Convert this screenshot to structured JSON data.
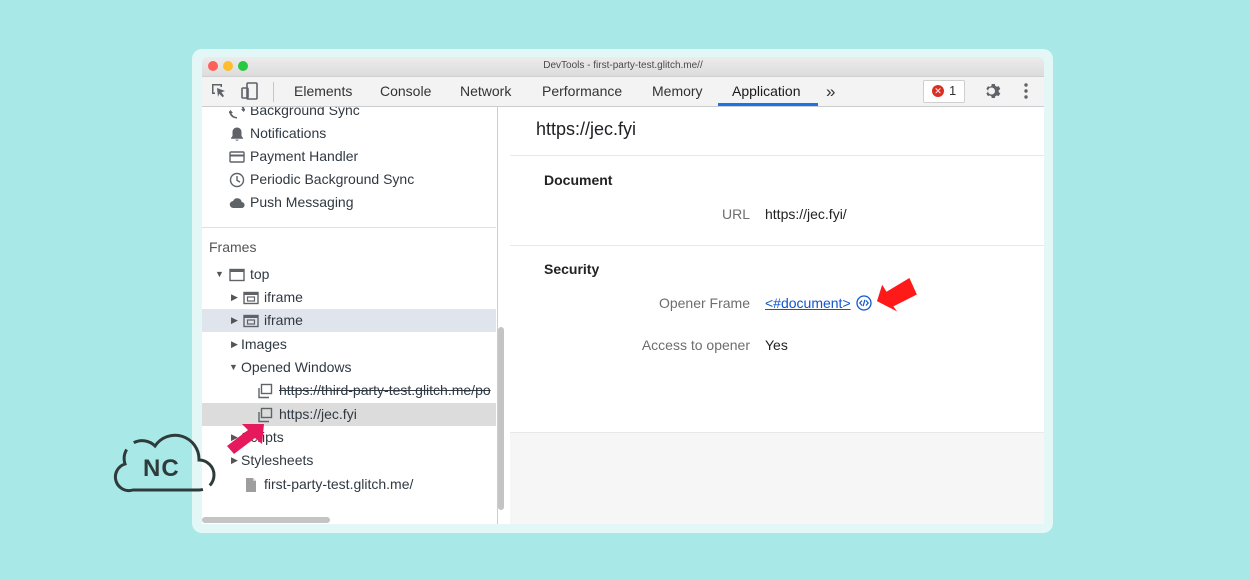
{
  "window": {
    "title": "DevTools - first-party-test.glitch.me//"
  },
  "toolbar": {
    "tabs": [
      "Elements",
      "Console",
      "Network",
      "Performance",
      "Memory",
      "Application"
    ],
    "active_tab": "Application",
    "more": "»",
    "error_count": "1"
  },
  "sidebar": {
    "items": [
      "Background Sync",
      "Notifications",
      "Payment Handler",
      "Periodic Background Sync",
      "Push Messaging"
    ],
    "frames_header": "Frames",
    "frames": {
      "top": "top",
      "iframe1": "iframe",
      "iframe2": "iframe",
      "images": "Images",
      "opened_windows": "Opened Windows",
      "window1": "https://third-party-test.glitch.me/po",
      "window2": "https://jec.fyi",
      "scripts": "Scripts",
      "stylesheets": "Stylesheets",
      "file": "first-party-test.glitch.me/"
    }
  },
  "main": {
    "title": "https://jec.fyi",
    "document": {
      "header": "Document",
      "url_label": "URL",
      "url_value": "https://jec.fyi/"
    },
    "security": {
      "header": "Security",
      "opener_label": "Opener Frame",
      "opener_value": "<#document>",
      "access_label": "Access to opener",
      "access_value": "Yes"
    }
  },
  "logo": {
    "text": "NC"
  },
  "colors": {
    "accent": "#1a73e8",
    "arrow_red": "#ff1a1a",
    "arrow_pink": "#e6195c",
    "background": "#a8e9e8"
  }
}
